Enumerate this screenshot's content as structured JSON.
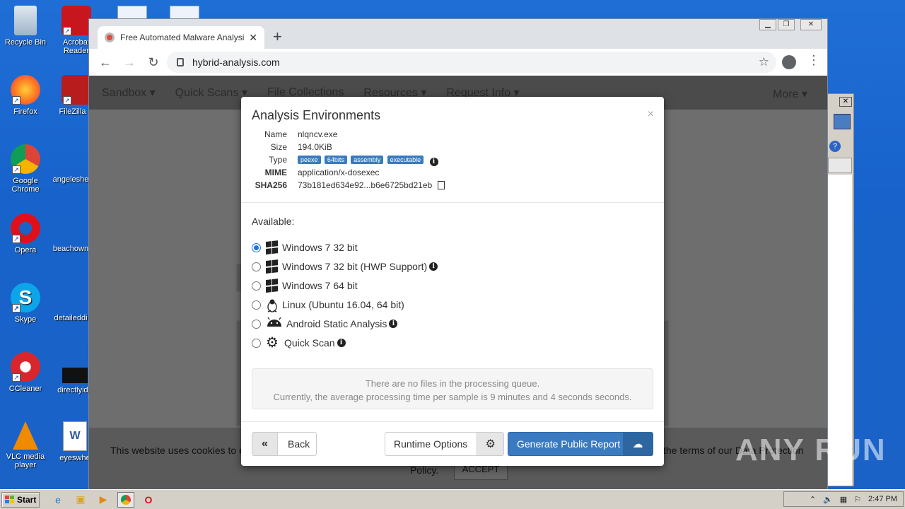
{
  "desktop": {
    "icons": [
      {
        "label": "Recycle Bin"
      },
      {
        "label": "Acrobat Reader"
      },
      {
        "label": "Firefox"
      },
      {
        "label": "FileZilla C"
      },
      {
        "label": "Google Chrome"
      },
      {
        "label": "angeleshe"
      },
      {
        "label": "Opera"
      },
      {
        "label": "beachown"
      },
      {
        "label": "Skype"
      },
      {
        "label": "detaileddi"
      },
      {
        "label": "CCleaner"
      },
      {
        "label": "directlyide"
      },
      {
        "label": "VLC media player"
      },
      {
        "label": "eyeswhe"
      }
    ]
  },
  "browser": {
    "tab_title": "Free Automated Malware Analysis S",
    "url": "hybrid-analysis.com"
  },
  "site_nav": {
    "items": [
      "Sandbox ▾",
      "Quick Scans ▾",
      "File Collections",
      "Resources ▾",
      "Request Info ▾"
    ],
    "more": "More ▾"
  },
  "cookie": {
    "text_left": "This website uses cookies to e",
    "text_right": "the terms of our Data Protection",
    "policy": "Policy.",
    "accept": "ACCEPT"
  },
  "modal": {
    "title": "Analysis Environments",
    "close": "×",
    "props": {
      "name_k": "Name",
      "name_v": "nlqncv.exe",
      "size_k": "Size",
      "size_v": "194.0KiB",
      "type_k": "Type",
      "type_badges": [
        "peexe",
        "64bits",
        "assembly",
        "executable"
      ],
      "mime_k": "MIME",
      "mime_v": "application/x-dosexec",
      "sha_k": "SHA256",
      "sha_v": "73b181ed634e92...b6e6725bd21eb"
    },
    "available_label": "Available:",
    "environments": [
      {
        "label": "Windows 7 32 bit",
        "icon": "windows-icon",
        "selected": true
      },
      {
        "label": "Windows 7 32 bit (HWP Support)",
        "icon": "windows-icon",
        "selected": false
      },
      {
        "label": "Windows 7 64 bit",
        "icon": "windows-icon",
        "selected": false
      },
      {
        "label": "Linux (Ubuntu 16.04, 64 bit)",
        "icon": "linux-icon",
        "selected": false
      },
      {
        "label": "Android Static Analysis",
        "icon": "android-icon",
        "selected": false
      },
      {
        "label": "Quick Scan",
        "icon": "gear-icon",
        "selected": false
      }
    ],
    "queue_line1": "There are no files in the processing queue.",
    "queue_line2": "Currently, the average processing time per sample is 9 minutes and 4 seconds seconds.",
    "back_label": "Back",
    "runtime_label": "Runtime Options",
    "generate_label": "Generate Public Report"
  },
  "taskbar": {
    "start": "Start",
    "clock": "2:47 PM"
  },
  "watermark": "ANY RUN"
}
